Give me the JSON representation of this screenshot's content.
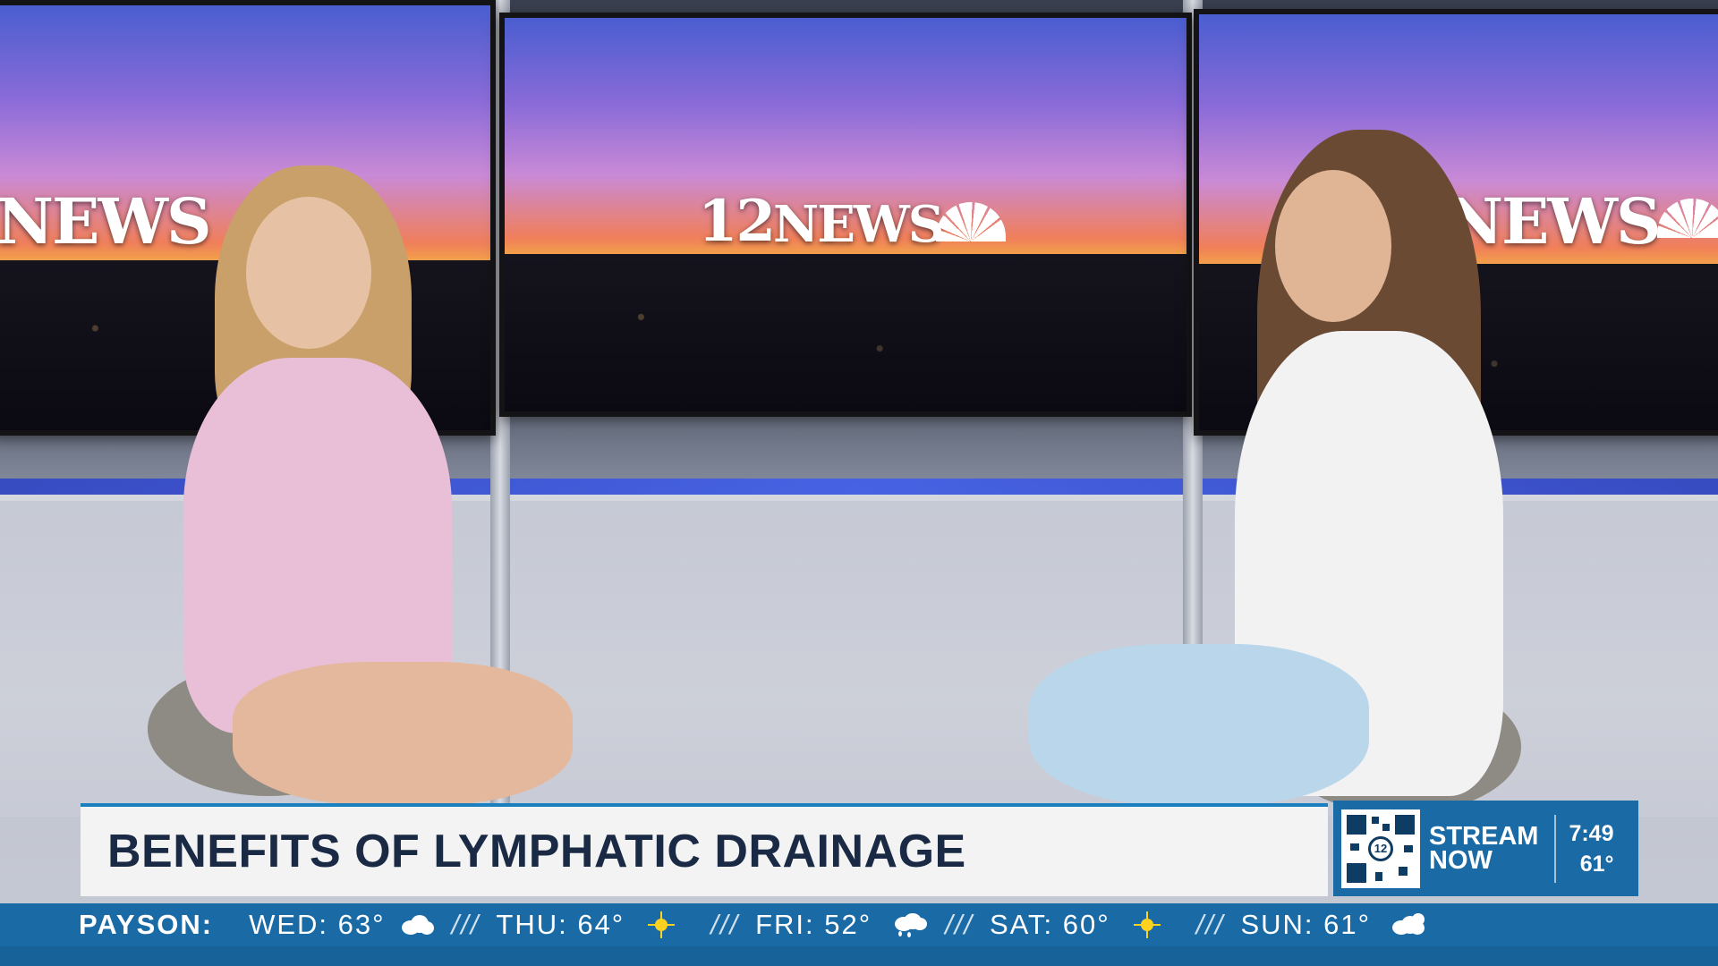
{
  "screens": {
    "left_logo": "NEWS",
    "center_logo_number": "12",
    "center_logo_word": "NEWS",
    "right_logo": "NEWS"
  },
  "lower_third": {
    "headline": "BENEFITS OF LYMPHATIC DRAINAGE"
  },
  "stream": {
    "line1": "STREAM",
    "line2": "NOW",
    "qr_logo": "12",
    "time": "7:49",
    "temperature": "61°"
  },
  "ticker": {
    "location": "PAYSON:",
    "days": [
      {
        "label": "WED: 63°",
        "icon": "partly-cloudy-icon"
      },
      {
        "label": "THU: 64°",
        "icon": "sun-icon"
      },
      {
        "label": "FRI: 52°",
        "icon": "rain-cloud-icon"
      },
      {
        "label": "SAT: 60°",
        "icon": "sun-icon"
      },
      {
        "label": "SUN: 61°",
        "icon": "partly-cloudy-icon"
      }
    ],
    "separator": "///"
  },
  "colors": {
    "ticker_bg": "#1a6aa6",
    "headline_text": "#1b2a44",
    "lower_third_bg": "#f3f3f3",
    "sun_yellow": "#ffd21f"
  }
}
